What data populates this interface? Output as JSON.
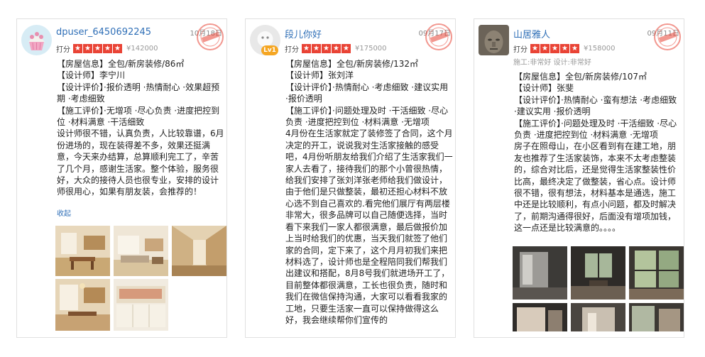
{
  "colors": {
    "username": "#2f6fb7",
    "stars": "#e94335",
    "badge": "#f5a623"
  },
  "reviews": [
    {
      "username": "dpuser_6450692245",
      "date": "10月18日",
      "rating_label": "打分",
      "star_count": 5,
      "price": "¥142000",
      "house_info": "【房屋信息】全包/新房装修/86㎡",
      "designer": "【设计师】李宁川",
      "design_eval": "【设计评价】·报价透明 ·热情耐心 ·效果超预期 ·考虑细致",
      "build_eval": "【施工评价】·无增项 ·尽心负责 ·进度把控到位 ·材料满意 ·干活细致",
      "content": "设计师很不错，认真负责，人比较靠谱，6月份进场的，现在装得差不多，效果还挺满意，今天来办结算，总算顺利完工了，辛苦了几个月，感谢生活家。整个体验，服务很好，大众的接待人员也很专业，安排的设计师很用心，如果有朋友装，会推荐的！",
      "collapse_label": "收起",
      "photos": [
        "dining-room-photo",
        "living-room-photo",
        "hallway-photo",
        "kitchen-dining-photo",
        "cabinet-photo"
      ]
    },
    {
      "username": "段儿你好",
      "badge": "Lv1",
      "date": "09月17日",
      "rating_label": "打分",
      "star_count": 5,
      "price": "¥175000",
      "house_info": "【房屋信息】全包/新房装修/132㎡",
      "designer": "【设计师】张刘洋",
      "design_eval": "【设计评价】·热情耐心 ·考虑细致 ·建议实用 ·报价透明",
      "build_eval": "【施工评价】·问题处理及时 ·干活细致 ·尽心负责 ·进度把控到位 ·材料满意 ·无增项",
      "content": "4月份在生活家就定了装修签了合同，这个月决定的开工，说说我对生活家接触的感受吧，4月份听朋友给我们介绍了生活家我们一家人去看了，接待我们的那个小曾很热情，给我们安排了张刘洋张老师给我们做设计，由于他们是只做整装，最初还担心材料不放心选不到自己喜欢的.看完他们展厅有两层楼非常大，很多品牌可以自己随便选择，当时看下来我们一家人都很满意，最后做报价加上当时给我们的优惠，当天我们就签了他们家的合同，定下来了，这个月月初我们来把材料选了，设计师也是全程陪同我们帮我们出建议和搭配，8月8号我们就进场开工了，目前整体都很满意，工长也很负责，随时和我们在微信保持沟通，大家可以看看我家的工地，只要生活家一直可以保持做得这么好，我会继续帮你们宣传的"
    },
    {
      "username": "山居雅人",
      "date": "09月11日",
      "rating_label": "打分",
      "star_count": 5,
      "price": "¥158000",
      "sub_ratings": "施工:非常好  设计:非常好",
      "house_info": "【房屋信息】全包/新房装修/107㎡",
      "designer": "【设计师】张斐",
      "design_eval": "【设计评价】·热情耐心 ·蛮有想法 ·考虑细致 ·建议实用 ·报价透明",
      "build_eval": "【施工评价】·问题处理及时 ·干活细致 ·尽心负责 ·进度把控到位 ·材料满意 ·无增项",
      "content": "房子在照母山，在小区看到有在建工地，朋友也推荐了生活家装饰，本来不太考虑整装的，综合对比后，还是觉得生活家整装性价比高，最终决定了做整装，省心点。设计师很不错，很有想法，材料基本是通选，施工中还是比较顺利，有点小问题，都及时解决了，前期沟通得很好，后面没有增项加钱，这一点还是比较满意的。。。。",
      "photos": [
        "construction-room-photo",
        "window-room-photo",
        "balcony-photo",
        "ceiling-photo",
        "wall-photo",
        "corner-photo"
      ]
    }
  ]
}
